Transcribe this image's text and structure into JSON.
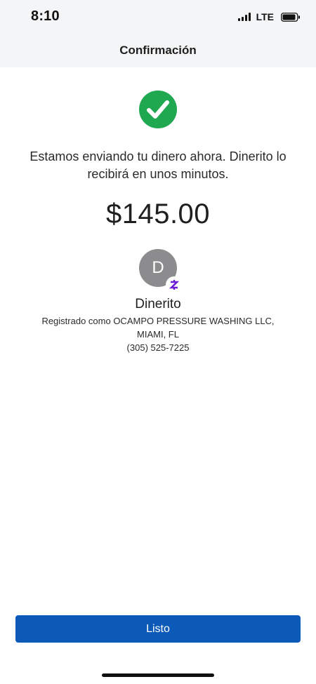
{
  "status_bar": {
    "time": "8:10",
    "network": "LTE",
    "icons": [
      "signal-icon",
      "battery-icon"
    ]
  },
  "header": {
    "title": "Confirmación"
  },
  "confirmation": {
    "icon": "check-circle-icon",
    "icon_color": "#1fa84f",
    "message": "Estamos enviando tu dinero ahora. Dinerito lo recibirá en unos minutos.",
    "amount": "$145.00"
  },
  "recipient": {
    "avatar_initial": "D",
    "badge_icon": "zelle-icon",
    "badge_color": "#6d1ed4",
    "name": "Dinerito",
    "registered_as": "Registrado como OCAMPO PRESSURE WASHING LLC,",
    "location": "MIAMI, FL",
    "phone": "(305) 525-7225"
  },
  "actions": {
    "done_label": "Listo",
    "button_color": "#0b5ab8"
  }
}
